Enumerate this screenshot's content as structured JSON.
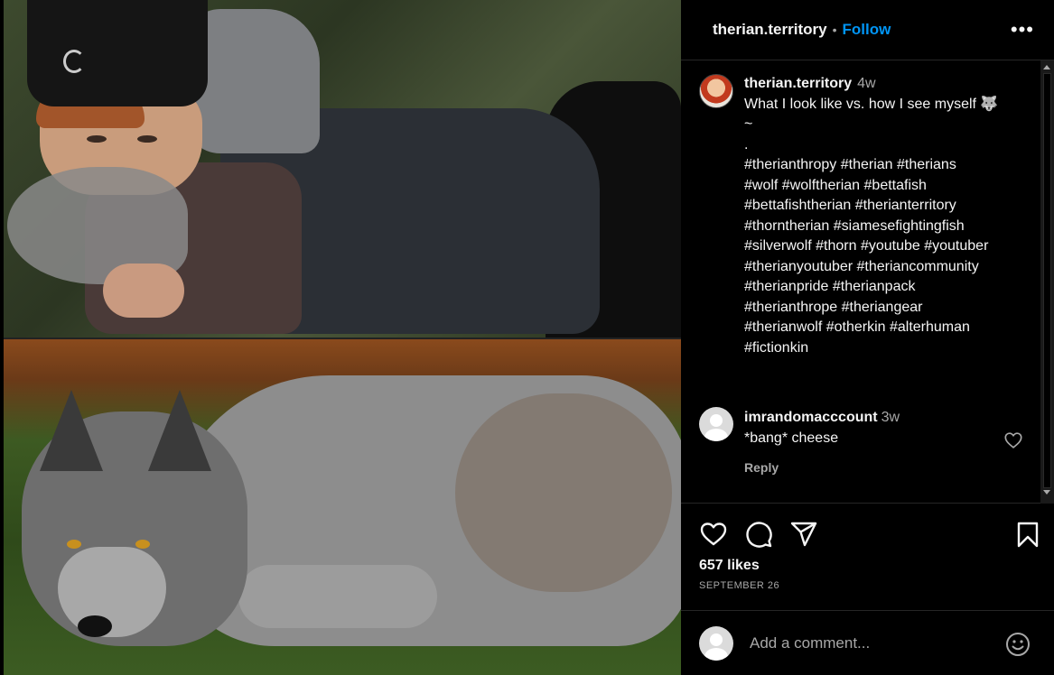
{
  "post": {
    "username": "therian.territory",
    "separator": "•",
    "follow_label": "Follow",
    "more_label": "•••"
  },
  "caption": {
    "username": "therian.territory",
    "time": "4w",
    "lines": [
      "What I look like vs. how I see myself 🐺",
      "~",
      ".",
      "#therianthropy #therian #therians",
      "#wolf #wolftherian #bettafish",
      "#bettafishtherian #therianterritory",
      "#thorntherian #siamesefightingfish",
      "#silverwolf #thorn #youtube #youtuber",
      "#therianyoutuber #theriancommunity",
      "#therianpride #therianpack",
      "#therianthrope #theriangear",
      "#therianwolf #otherkin #alterhuman",
      "#fictionkin"
    ]
  },
  "comments": [
    {
      "username": "imrandomacccount",
      "time": "3w",
      "text": "*bang* cheese",
      "reply_label": "Reply"
    }
  ],
  "stats": {
    "likes": "657 likes",
    "date": "SEPTEMBER 26"
  },
  "add_comment": {
    "placeholder": "Add a comment..."
  },
  "icons": {
    "like": "heart-icon",
    "comment": "comment-bubble-icon",
    "share": "paper-plane-icon",
    "save": "bookmark-icon",
    "emoji": "smiley-icon"
  },
  "colors": {
    "background": "#000000",
    "text": "#f5f5f5",
    "muted": "#a8a8a8",
    "accent": "#0095f6",
    "divider": "#262626"
  }
}
